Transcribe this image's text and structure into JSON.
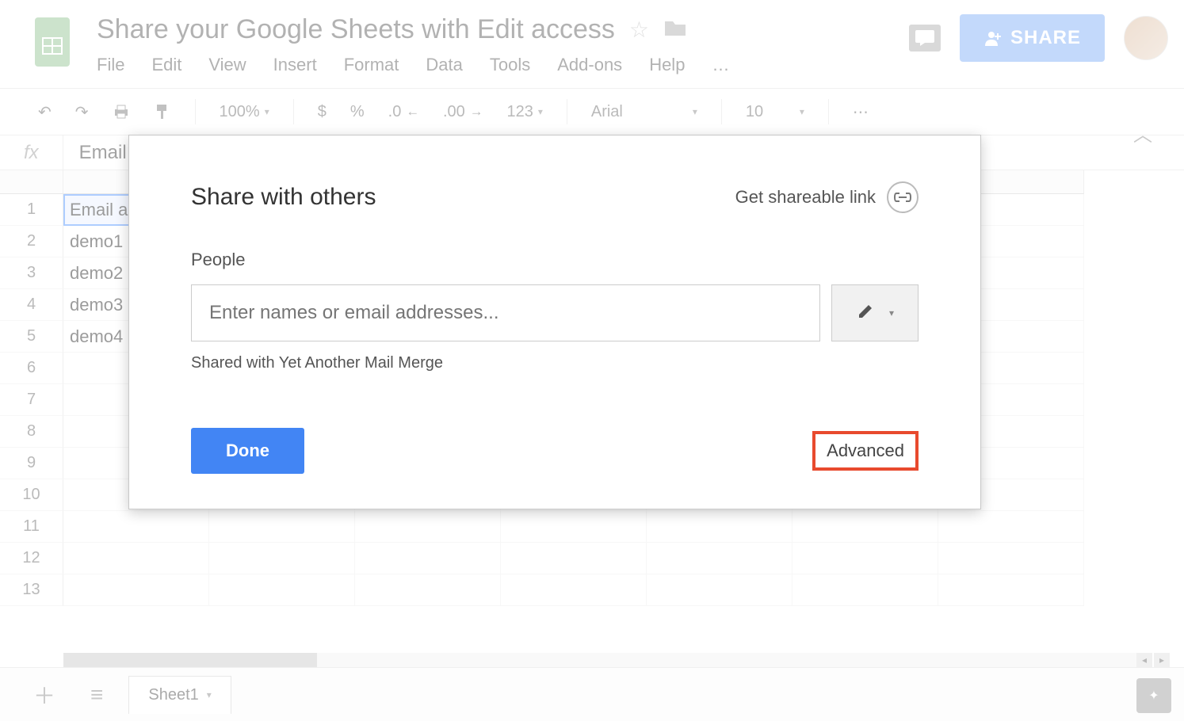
{
  "doc": {
    "title": "Share your Google Sheets with Edit access"
  },
  "menubar": [
    "File",
    "Edit",
    "View",
    "Insert",
    "Format",
    "Data",
    "Tools",
    "Add-ons",
    "Help"
  ],
  "toolbar": {
    "zoom": "100%",
    "currency": "$",
    "percent": "%",
    "dec_less": ".0",
    "dec_more": ".00",
    "num_format": "123",
    "font": "Arial",
    "font_size": "10",
    "more": "⋯"
  },
  "share_button": "SHARE",
  "formula": {
    "label": "fx",
    "value": "Email"
  },
  "grid": {
    "rows": [
      {
        "n": "1",
        "a": "Email a",
        "active": true
      },
      {
        "n": "2",
        "a": "demo1"
      },
      {
        "n": "3",
        "a": "demo2"
      },
      {
        "n": "4",
        "a": "demo3"
      },
      {
        "n": "5",
        "a": "demo4"
      },
      {
        "n": "6",
        "a": ""
      },
      {
        "n": "7",
        "a": ""
      },
      {
        "n": "8",
        "a": ""
      },
      {
        "n": "9",
        "a": ""
      },
      {
        "n": "10",
        "a": ""
      },
      {
        "n": "11",
        "a": ""
      },
      {
        "n": "12",
        "a": ""
      },
      {
        "n": "13",
        "a": ""
      }
    ]
  },
  "dialog": {
    "title": "Share with others",
    "get_link": "Get shareable link",
    "people_label": "People",
    "placeholder": "Enter names or email addresses...",
    "shared_with": "Shared with Yet Another Mail Merge",
    "done": "Done",
    "advanced": "Advanced"
  },
  "tabs": {
    "sheet1": "Sheet1"
  }
}
